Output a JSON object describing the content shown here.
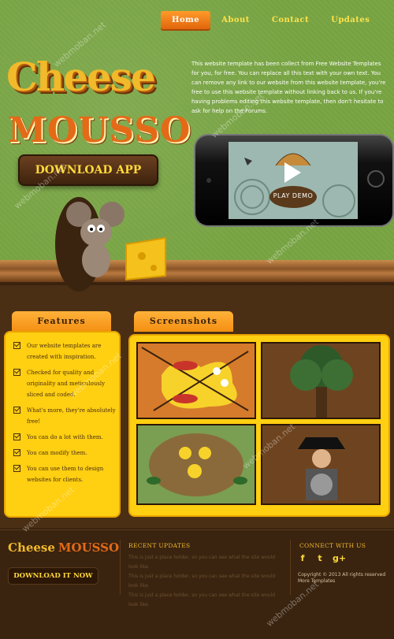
{
  "nav": {
    "items": [
      {
        "label": "Home",
        "active": true
      },
      {
        "label": "About",
        "active": false
      },
      {
        "label": "Contact",
        "active": false
      },
      {
        "label": "Updates",
        "active": false
      }
    ]
  },
  "hero": {
    "logo_line1": "Cheese",
    "logo_line2": "MOUSSO",
    "download_label": "DOWNLOAD APP",
    "intro_text": "This website template has been collect from Free Website Templates for you, for free. You can replace all this text with your own text. You can remove any link to our website from this website template, you're free to use this website template without linking back to us. If you're having problems editing this website template, then don't hesitate to ask for help on the Forums.",
    "play_label": "PLAY DEMO"
  },
  "sections": {
    "features_title": "Features",
    "screenshots_title": "Screenshots",
    "features": [
      "Our website templates are created with inspiration.",
      "Checked for quality and originality and meticulously sliced and coded.",
      "What's more, they're absolutely free!",
      "You can do a lot with them.",
      "You can modify them.",
      "You can use them to design websites for clients."
    ]
  },
  "footer": {
    "logo_a": "Cheese",
    "logo_b": "MOUSSO",
    "download_label": "DOWNLOAD IT NOW",
    "updates_title": "RECENT UPDATES",
    "updates": [
      "This is just a place holder, so you can see what the site would look like.",
      "This is just a place holder, so you can see what the site would look like.",
      "This is just a place holder, so you can see what the site would look like."
    ],
    "connect_title": "CONNECT WITH US",
    "copyright": "Copyright © 2013 All rights reserved More Templates"
  },
  "watermark": "webmoban.net",
  "colors": {
    "accent": "#ffcf11",
    "nav_active": "#f07a15",
    "background_top": "#7aa645",
    "background_bottom": "#4a2f15"
  },
  "icons": [
    "play-icon",
    "check-icon",
    "facebook-icon",
    "twitter-icon",
    "google-plus-icon"
  ]
}
